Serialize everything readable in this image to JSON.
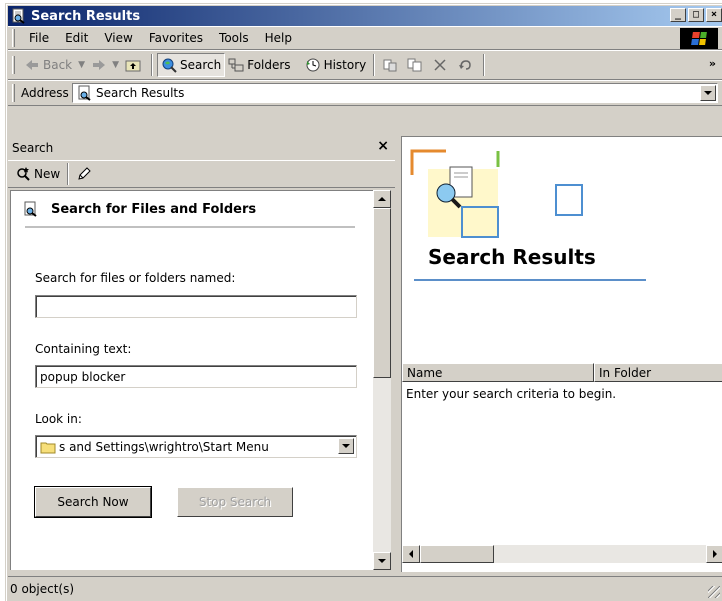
{
  "window": {
    "title": "Search Results",
    "caption": {
      "minimize": "_",
      "maximize": "□",
      "close": "×"
    }
  },
  "menu": [
    "File",
    "Edit",
    "View",
    "Favorites",
    "Tools",
    "Help"
  ],
  "toolbar": {
    "back": "Back",
    "search": "Search",
    "folders": "Folders",
    "history": "History",
    "chevron": "»"
  },
  "address": {
    "label": "Address",
    "value": "Search Results"
  },
  "search_pane": {
    "header": "Search",
    "close": "×",
    "new_label": "New",
    "title": "Search for Files and Folders",
    "named_label": "Search for files or folders named:",
    "named_value": "",
    "containing_label": "Containing text:",
    "containing_value": "popup blocker",
    "lookin_label": "Look in:",
    "lookin_value": "s and Settings\\wrightro\\Start Menu",
    "search_now": "Search Now",
    "stop_search": "Stop Search"
  },
  "results": {
    "title": "Search Results",
    "columns": [
      "Name",
      "In Folder"
    ],
    "empty_message": "Enter your search criteria to begin."
  },
  "status": {
    "text": "0 object(s)"
  },
  "colors": {
    "titlebar_start": "#0a246a",
    "titlebar_end": "#a6caf0",
    "face": "#d4d0c8",
    "accent_rule": "#5b8fc9"
  },
  "icons": {
    "app": "search-doc-icon",
    "back": "back-arrow-icon",
    "forward": "forward-arrow-icon",
    "up": "up-folder-icon",
    "search": "search-globe-icon",
    "folders": "folders-icon",
    "history": "history-icon",
    "move_to": "move-to-icon",
    "copy_to": "copy-to-icon",
    "delete": "delete-icon",
    "undo": "undo-icon",
    "new": "new-search-icon",
    "tools": "pen-icon",
    "folder": "folder-icon",
    "windows_flag": "windows-flag-icon"
  }
}
